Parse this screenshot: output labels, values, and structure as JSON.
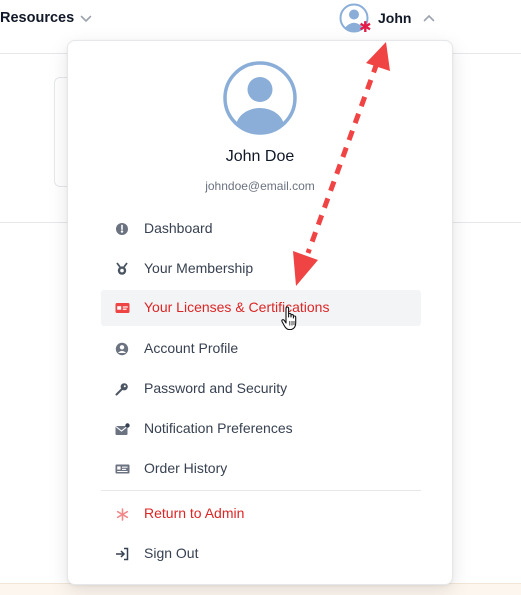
{
  "nav": {
    "resources_label": "Resources",
    "user_name": "John"
  },
  "profile": {
    "name": "John Doe",
    "email": "johndoe@email.com"
  },
  "menu": {
    "items": [
      {
        "label": "Dashboard",
        "icon": "dashboard-icon"
      },
      {
        "label": "Your Membership",
        "icon": "medal-icon"
      },
      {
        "label": "Your Licenses & Certifications",
        "icon": "id-card-icon",
        "active": true
      },
      {
        "label": "Account Profile",
        "icon": "user-circle-icon"
      },
      {
        "label": "Password and Security",
        "icon": "key-icon"
      },
      {
        "label": "Notification Preferences",
        "icon": "mail-notification-icon"
      },
      {
        "label": "Order History",
        "icon": "receipt-icon"
      }
    ],
    "admin": {
      "label": "Return to Admin",
      "icon": "asterisk-icon"
    },
    "signout": {
      "label": "Sign Out",
      "icon": "sign-out-icon"
    }
  },
  "colors": {
    "accent_red": "#dc2626",
    "avatar_blue": "#8aaed8",
    "annotation_red": "#f04444",
    "active_bg": "#f3f4f6"
  }
}
